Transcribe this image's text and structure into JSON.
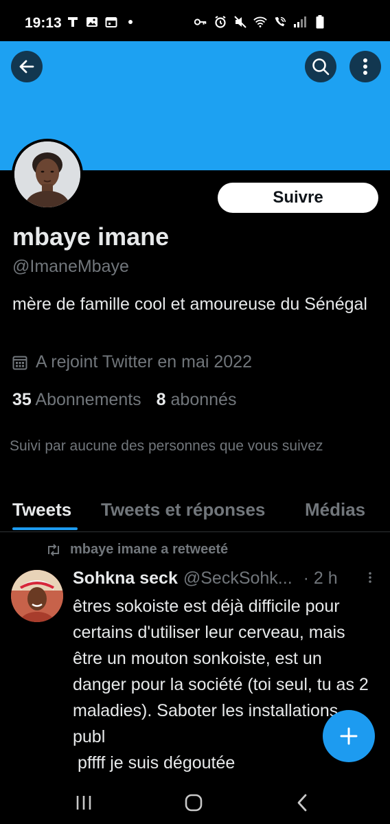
{
  "status_bar": {
    "time": "19:13",
    "left_icons": [
      "t-notification-icon",
      "image-notification-icon",
      "calendar-notification-icon",
      "dot-icon"
    ],
    "right_icons": [
      "key-icon",
      "alarm-icon",
      "mute-icon",
      "wifi-icon",
      "wifi-call-icon",
      "signal-icon",
      "battery-icon"
    ]
  },
  "header": {
    "banner_color": "#1da1f2",
    "back_icon": "arrow-left-icon",
    "search_icon": "search-icon",
    "more_icon": "more-vertical-icon"
  },
  "profile": {
    "follow_label": "Suivre",
    "name": "mbaye imane",
    "handle": "@ImaneMbaye",
    "bio": "mère de famille  cool et amoureuse du Sénégal",
    "joined_icon": "calendar-icon",
    "joined": "A rejoint Twitter en mai 2022",
    "following_count": "35",
    "following_label": "Abonnements",
    "followers_count": "8",
    "followers_label": "abonnés",
    "followed_by": "Suivi par aucune des personnes que vous suivez"
  },
  "tabs": [
    {
      "label": "Tweets",
      "active": true
    },
    {
      "label": "Tweets et réponses",
      "active": false
    },
    {
      "label": "Médias",
      "active": false
    }
  ],
  "tweet": {
    "retweet_label": "mbaye imane a retweeté",
    "author_name": "Sohkna seck",
    "author_handle": "@SeckSohk...",
    "time": "· 2 h",
    "text": "êtres sokoiste est déjà difficile pour certains d'utiliser leur cerveau, mais être un mouton sonkoiste, est un danger pour la société (toi seul, tu as 2 maladies). Saboter les installations publ",
    "text_line2": " pffff je suis dégoutée"
  },
  "accent_color": "#1d9bf0",
  "fab_icon": "plus-icon",
  "nav_bar": {
    "icons": [
      "recent-apps-icon",
      "home-icon",
      "back-icon"
    ]
  }
}
